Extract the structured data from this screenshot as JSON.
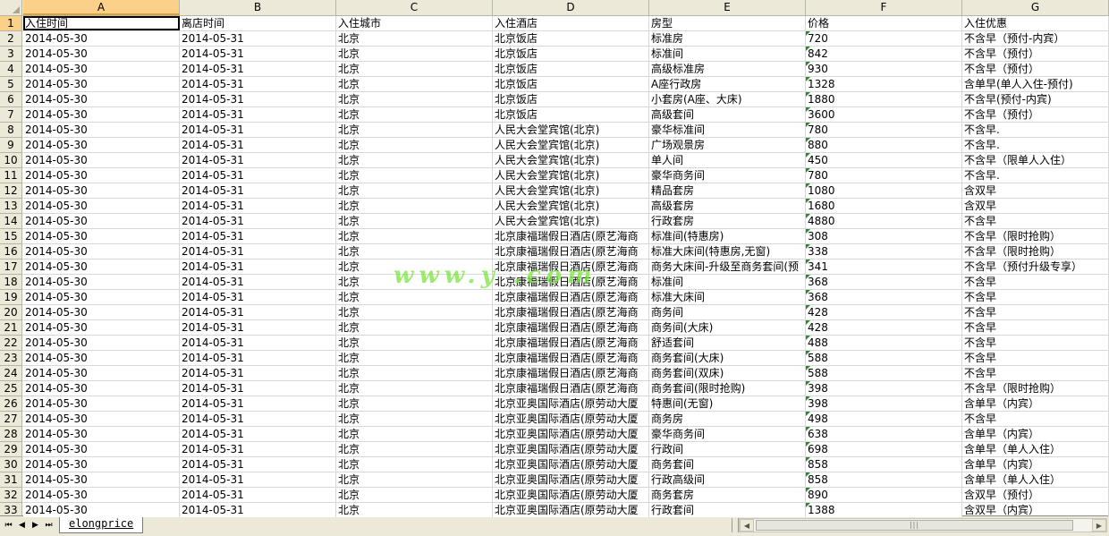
{
  "columns": [
    "A",
    "B",
    "C",
    "D",
    "E",
    "F",
    "G"
  ],
  "selected_column": "A",
  "selected_row": "1",
  "rows": [
    [
      "1",
      "入住时间",
      "离店时间",
      "入住城市",
      "入住酒店",
      "房型",
      "价格",
      "入住优惠"
    ],
    [
      "2",
      "2014-05-30",
      "2014-05-31",
      "北京",
      "北京饭店",
      "标准房",
      "720",
      "不含早（预付-内宾）"
    ],
    [
      "3",
      "2014-05-30",
      "2014-05-31",
      "北京",
      "北京饭店",
      "标准间",
      "842",
      "不含早（预付）"
    ],
    [
      "4",
      "2014-05-30",
      "2014-05-31",
      "北京",
      "北京饭店",
      "高级标准房",
      "930",
      "不含早（预付）"
    ],
    [
      "5",
      "2014-05-30",
      "2014-05-31",
      "北京",
      "北京饭店",
      "A座行政房",
      "1328",
      "含单早(单人入住-预付)"
    ],
    [
      "6",
      "2014-05-30",
      "2014-05-31",
      "北京",
      "北京饭店",
      "小套房(A座、大床)",
      "1880",
      "不含早(预付-内宾)"
    ],
    [
      "7",
      "2014-05-30",
      "2014-05-31",
      "北京",
      "北京饭店",
      "高级套间",
      "3600",
      "不含早（预付）"
    ],
    [
      "8",
      "2014-05-30",
      "2014-05-31",
      "北京",
      "人民大会堂宾馆(北京)",
      "豪华标准间",
      "780",
      "不含早."
    ],
    [
      "9",
      "2014-05-30",
      "2014-05-31",
      "北京",
      "人民大会堂宾馆(北京)",
      "广场观景房",
      "880",
      "不含早."
    ],
    [
      "10",
      "2014-05-30",
      "2014-05-31",
      "北京",
      "人民大会堂宾馆(北京)",
      "单人间",
      "450",
      "不含早（限单人入住）"
    ],
    [
      "11",
      "2014-05-30",
      "2014-05-31",
      "北京",
      "人民大会堂宾馆(北京)",
      "豪华商务间",
      "780",
      "不含早."
    ],
    [
      "12",
      "2014-05-30",
      "2014-05-31",
      "北京",
      "人民大会堂宾馆(北京)",
      "精品套房",
      "1080",
      "含双早"
    ],
    [
      "13",
      "2014-05-30",
      "2014-05-31",
      "北京",
      "人民大会堂宾馆(北京)",
      "高级套房",
      "1680",
      "含双早"
    ],
    [
      "14",
      "2014-05-30",
      "2014-05-31",
      "北京",
      "人民大会堂宾馆(北京)",
      "行政套房",
      "4880",
      "不含早"
    ],
    [
      "15",
      "2014-05-30",
      "2014-05-31",
      "北京",
      "北京康福瑞假日酒店(原艺海商",
      "标准间(特惠房)",
      "308",
      "不含早（限时抢购）"
    ],
    [
      "16",
      "2014-05-30",
      "2014-05-31",
      "北京",
      "北京康福瑞假日酒店(原艺海商",
      "标准大床间(特惠房,无窗)",
      "338",
      "不含早（限时抢购）"
    ],
    [
      "17",
      "2014-05-30",
      "2014-05-31",
      "北京",
      "北京康福瑞假日酒店(原艺海商",
      "商务大床间-升级至商务套间(预",
      "341",
      "不含早（预付升级专享）"
    ],
    [
      "18",
      "2014-05-30",
      "2014-05-31",
      "北京",
      "北京康福瑞假日酒店(原艺海商",
      "标准间",
      "368",
      "不含早"
    ],
    [
      "19",
      "2014-05-30",
      "2014-05-31",
      "北京",
      "北京康福瑞假日酒店(原艺海商",
      "标准大床间",
      "368",
      "不含早"
    ],
    [
      "20",
      "2014-05-30",
      "2014-05-31",
      "北京",
      "北京康福瑞假日酒店(原艺海商",
      "商务间",
      "428",
      "不含早"
    ],
    [
      "21",
      "2014-05-30",
      "2014-05-31",
      "北京",
      "北京康福瑞假日酒店(原艺海商",
      "商务间(大床)",
      "428",
      "不含早"
    ],
    [
      "22",
      "2014-05-30",
      "2014-05-31",
      "北京",
      "北京康福瑞假日酒店(原艺海商",
      "舒适套间",
      "488",
      "不含早"
    ],
    [
      "23",
      "2014-05-30",
      "2014-05-31",
      "北京",
      "北京康福瑞假日酒店(原艺海商",
      "商务套间(大床)",
      "588",
      "不含早"
    ],
    [
      "24",
      "2014-05-30",
      "2014-05-31",
      "北京",
      "北京康福瑞假日酒店(原艺海商",
      "商务套间(双床)",
      "588",
      "不含早"
    ],
    [
      "25",
      "2014-05-30",
      "2014-05-31",
      "北京",
      "北京康福瑞假日酒店(原艺海商",
      "商务套间(限时抢购)",
      "398",
      "不含早（限时抢购）"
    ],
    [
      "26",
      "2014-05-30",
      "2014-05-31",
      "北京",
      "北京亚奥国际酒店(原劳动大厦",
      "特惠间(无窗)",
      "398",
      "含单早（内宾）"
    ],
    [
      "27",
      "2014-05-30",
      "2014-05-31",
      "北京",
      "北京亚奥国际酒店(原劳动大厦",
      "商务房",
      "498",
      "不含早"
    ],
    [
      "28",
      "2014-05-30",
      "2014-05-31",
      "北京",
      "北京亚奥国际酒店(原劳动大厦",
      "豪华商务间",
      "638",
      "含单早（内宾）"
    ],
    [
      "29",
      "2014-05-30",
      "2014-05-31",
      "北京",
      "北京亚奥国际酒店(原劳动大厦",
      "行政间",
      "698",
      "含单早（单人入住）"
    ],
    [
      "30",
      "2014-05-30",
      "2014-05-31",
      "北京",
      "北京亚奥国际酒店(原劳动大厦",
      "商务套间",
      "858",
      "含单早（内宾）"
    ],
    [
      "31",
      "2014-05-30",
      "2014-05-31",
      "北京",
      "北京亚奥国际酒店(原劳动大厦",
      "行政高级间",
      "858",
      "含单早（单人入住）"
    ],
    [
      "32",
      "2014-05-30",
      "2014-05-31",
      "北京",
      "北京亚奥国际酒店(原劳动大厦",
      "商务套房",
      "890",
      "含双早（预付）"
    ],
    [
      "33",
      "2014-05-30",
      "2014-05-31",
      "北京",
      "北京亚奥国际酒店(原劳动大厦",
      "行政套间",
      "1388",
      "含双早（内宾）"
    ]
  ],
  "watermark": "www.y          .com",
  "sheet_tab": "elongprice",
  "nav_buttons": [
    "⏮",
    "◀",
    "▶",
    "⏭"
  ]
}
